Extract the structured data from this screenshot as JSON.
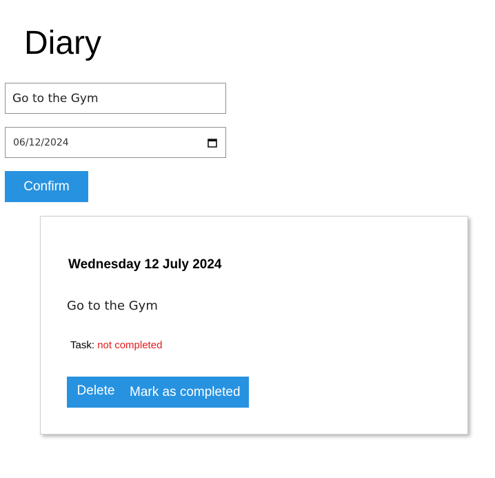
{
  "app": {
    "title": "Diary"
  },
  "form": {
    "task_value": "Go to the Gym",
    "date_value": "06/12/2024",
    "confirm_label": "Confirm"
  },
  "icons": {
    "date_picker": "calendar-icon"
  },
  "colors": {
    "accent": "#2792e0",
    "status_incomplete": "#e01b1b"
  },
  "entry": {
    "date_heading": "Wednesday 12 July 2024",
    "text": "Go to the Gym",
    "status_label": "Task:",
    "status_value": "not completed",
    "delete_label": "Delete",
    "complete_label": "Mark as completed"
  }
}
